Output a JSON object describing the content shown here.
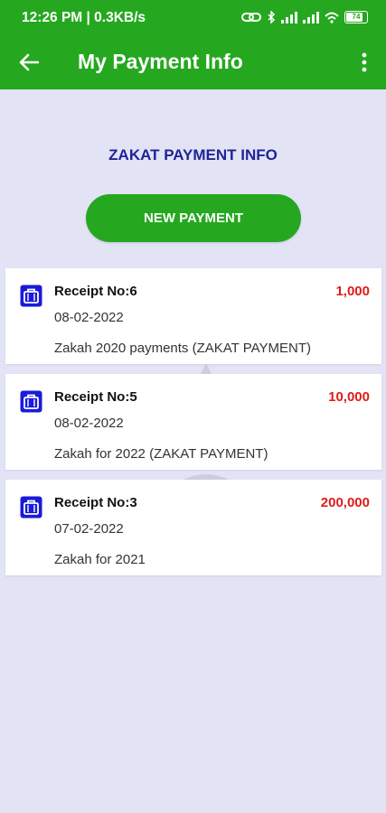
{
  "status_bar": {
    "time_speed": "12:26 PM | 0.3KB/s",
    "battery": "74",
    "battery_level": 0.74
  },
  "app_bar": {
    "title": "My Payment Info"
  },
  "section_title": "ZAKAT PAYMENT INFO",
  "new_payment_label": "NEW PAYMENT",
  "colors": {
    "primary": "#25a81f",
    "title_blue": "#1d2496",
    "amount_red": "#e01a1a",
    "background": "#e3e3f6",
    "icon_blue": "#1a1adb"
  },
  "payments": [
    {
      "receipt": "Receipt No:6",
      "amount": "1,000",
      "date": "08-02-2022",
      "description": "Zakah 2020 payments (ZAKAT PAYMENT)"
    },
    {
      "receipt": "Receipt No:5",
      "amount": "10,000",
      "date": "08-02-2022",
      "description": "Zakah for 2022 (ZAKAT PAYMENT)"
    },
    {
      "receipt": "Receipt No:3",
      "amount": "200,000",
      "date": "07-02-2022",
      "description": "Zakah for 2021"
    }
  ]
}
